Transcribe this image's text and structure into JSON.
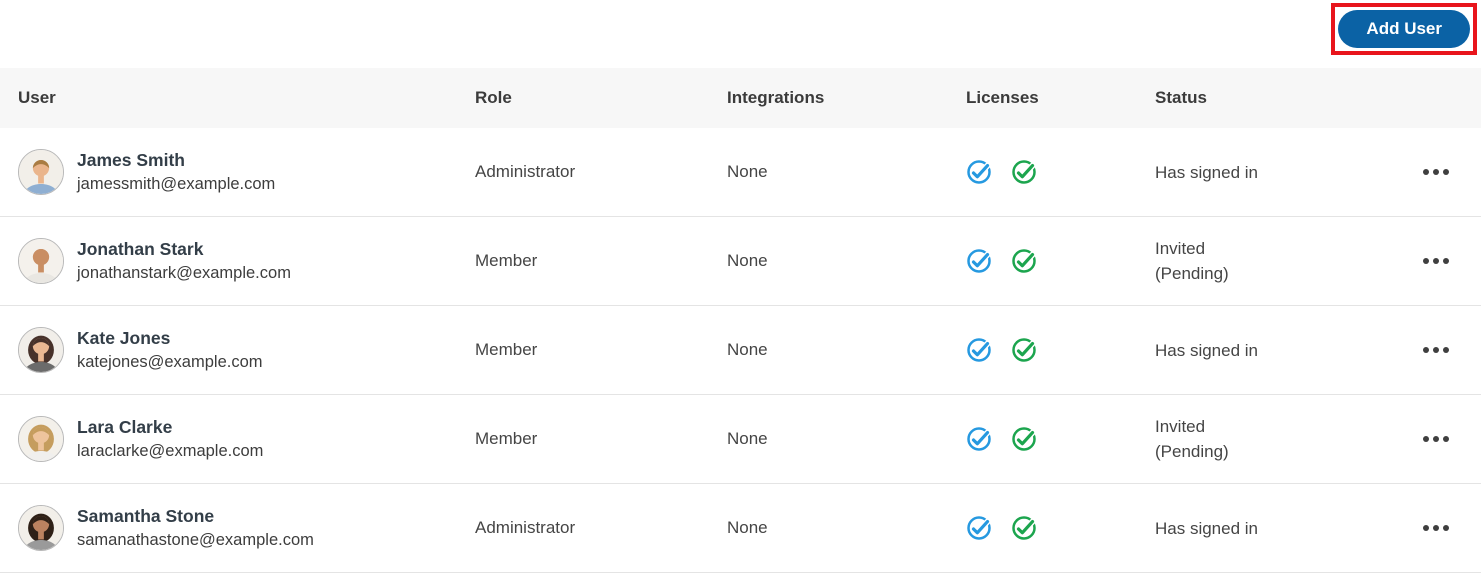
{
  "colors": {
    "license_blue": "#2699e0",
    "license_green": "#1ca54e",
    "button_blue": "#0b62a5",
    "highlight_red": "#e8151c",
    "header_bg": "#f7f7f7",
    "row_border": "#e4e4e4"
  },
  "toolbar": {
    "add_user_label": "Add User"
  },
  "icons": {
    "license_icons": [
      "blue-check-circle-icon",
      "green-check-circle-icon"
    ],
    "row_menu": "ellipsis-icon"
  },
  "table": {
    "headers": {
      "user": "User",
      "role": "Role",
      "integrations": "Integrations",
      "licenses": "Licenses",
      "status": "Status"
    },
    "rows": [
      {
        "name": "James Smith",
        "email": "jamessmith@example.com",
        "role": "Administrator",
        "integrations": "None",
        "status": "Has signed in",
        "status2": "",
        "avatar": {
          "bg": "#f2efe9",
          "hair_back": "#f2efe9",
          "skin": "#eab58c",
          "fringe": "#a97c42",
          "shirt": "#8fafd2"
        }
      },
      {
        "name": "Jonathan Stark",
        "email": "jonathanstark@example.com",
        "role": "Member",
        "integrations": "None",
        "status": "Invited",
        "status2": "(Pending)",
        "avatar": {
          "bg": "#f4f1ec",
          "hair_back": "#f4f1ec",
          "skin": "#c98e63",
          "fringe": "#c98e63",
          "shirt": "#e9e7e2"
        }
      },
      {
        "name": "Kate Jones",
        "email": "katejones@example.com",
        "role": "Member",
        "integrations": "None",
        "status": "Has signed in",
        "status2": "",
        "avatar": {
          "bg": "#f1eee9",
          "hair_back": "#47312a",
          "skin": "#eab893",
          "fringe": "#47312a",
          "shirt": "#6b6b6b"
        }
      },
      {
        "name": "Lara Clarke",
        "email": "laraclarke@exmaple.com",
        "role": "Member",
        "integrations": "None",
        "status": "Invited",
        "status2": "(Pending)",
        "avatar": {
          "bg": "#f3f0ea",
          "hair_back": "#c59d5e",
          "skin": "#eec49d",
          "fringe": "#c59d5e",
          "shirt": "#f0efed"
        }
      },
      {
        "name": "Samantha Stone",
        "email": "samanathastone@example.com",
        "role": "Administrator",
        "integrations": "None",
        "status": "Has signed in",
        "status2": "",
        "avatar": {
          "bg": "#f2efe9",
          "hair_back": "#2e2017",
          "skin": "#bb8260",
          "fringe": "#2e2017",
          "shirt": "#9a9a9a"
        }
      }
    ]
  }
}
